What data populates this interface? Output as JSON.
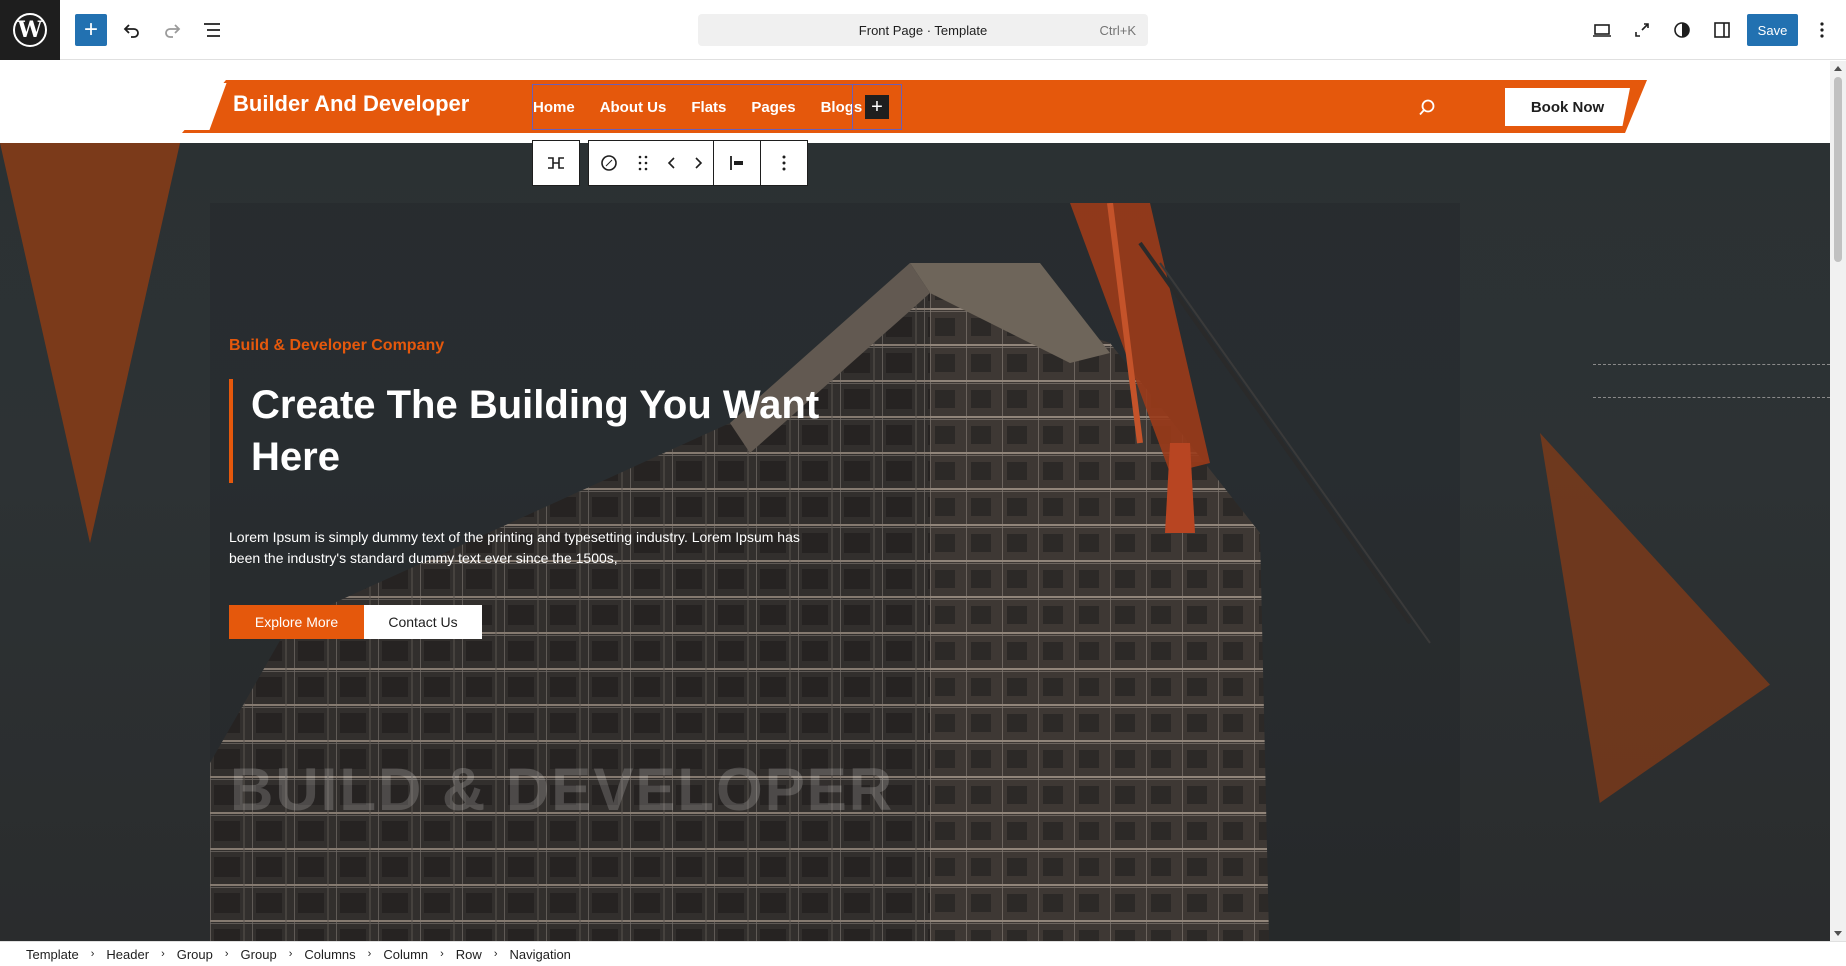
{
  "editor": {
    "document_title": "Front Page · Template",
    "shortcut": "Ctrl+K",
    "save_label": "Save"
  },
  "header": {
    "site_title": "Builder And Developer",
    "nav_items": [
      "Home",
      "About Us",
      "Flats",
      "Pages",
      "Blogs"
    ],
    "book_now_label": "Book Now"
  },
  "hero": {
    "tagline": "Build & Developer Company",
    "title": "Create The Building You Want Here",
    "description": "Lorem Ipsum is simply dummy text of the printing and typesetting industry. Lorem Ipsum has been the industry's standard dummy text ever since the 1500s,",
    "explore_label": "Explore More",
    "contact_label": "Contact Us",
    "watermark": "BUILD & DEVELOPER"
  },
  "breadcrumb": [
    "Template",
    "Header",
    "Group",
    "Group",
    "Columns",
    "Column",
    "Row",
    "Navigation"
  ],
  "colors": {
    "accent": "#e5580c",
    "primary": "#2271b1",
    "dark": "#1e1e1e"
  }
}
